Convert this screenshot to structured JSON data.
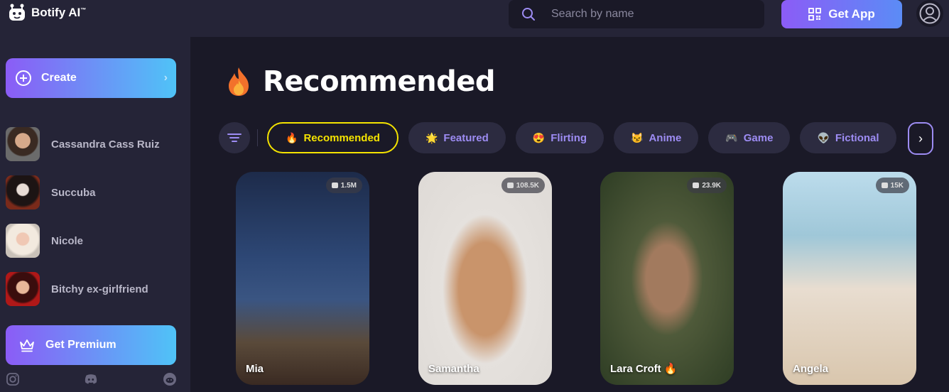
{
  "app": {
    "name": "Botify AI",
    "trademark": "™"
  },
  "search": {
    "placeholder": "Search by name"
  },
  "header": {
    "get_app_label": "Get App"
  },
  "sidebar": {
    "create_label": "Create",
    "items": [
      {
        "label": "Cassandra Cass Ruiz"
      },
      {
        "label": "Succuba"
      },
      {
        "label": "Nicole"
      },
      {
        "label": "Bitchy ex-girlfriend"
      }
    ],
    "premium_label": "Get Premium"
  },
  "main": {
    "title": "Recommended",
    "categories": [
      {
        "label": "Recommended",
        "emoji": "🔥",
        "active": true
      },
      {
        "label": "Featured",
        "emoji": "🌟",
        "active": false
      },
      {
        "label": "Flirting",
        "emoji": "😍",
        "active": false
      },
      {
        "label": "Anime",
        "emoji": "😼",
        "active": false
      },
      {
        "label": "Game",
        "emoji": "🎮",
        "active": false
      },
      {
        "label": "Fictional",
        "emoji": "👽",
        "active": false
      }
    ],
    "cards": [
      {
        "name": "Mia",
        "count": "1.5M"
      },
      {
        "name": "Samantha",
        "count": "108.5K"
      },
      {
        "name": "Lara Croft",
        "count": "23.9K",
        "badge": "🔥"
      },
      {
        "name": "Angela",
        "count": "15K"
      }
    ]
  },
  "colors": {
    "accent_purple": "#8b5cf6",
    "accent_blue": "#4fc3f7",
    "active_chip": "#f4e300",
    "chip_text": "#9d8cf3"
  }
}
